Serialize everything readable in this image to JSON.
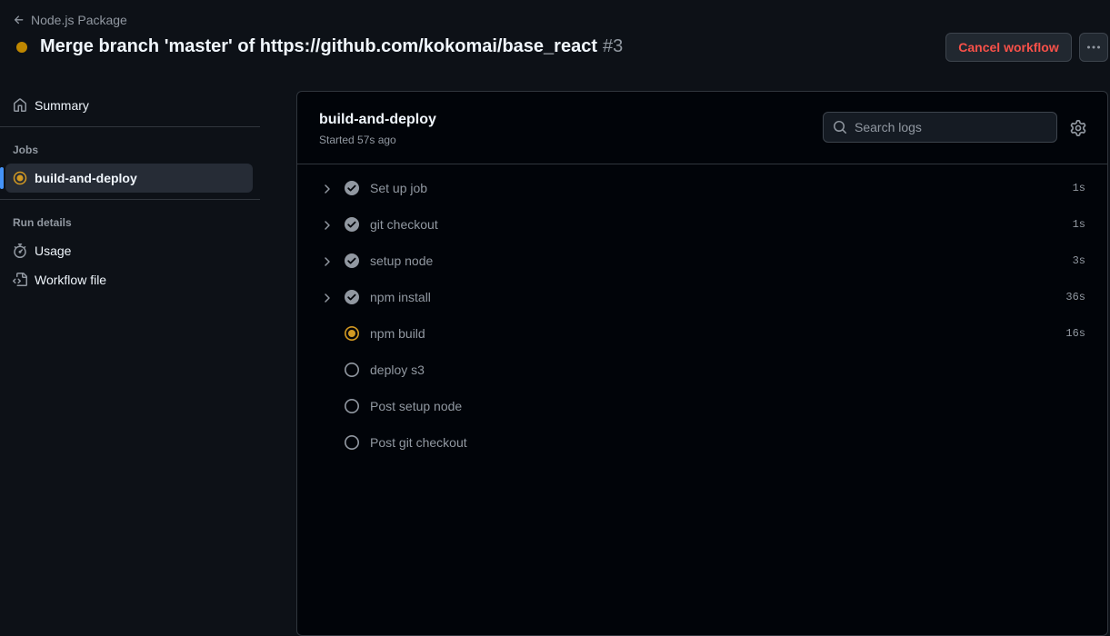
{
  "header": {
    "back_label": "Node.js Package",
    "run_title": "Merge branch 'master' of https://github.com/kokomai/base_react",
    "run_number": "#3",
    "cancel_label": "Cancel workflow",
    "status_color": "#bf8700"
  },
  "sidebar": {
    "summary_label": "Summary",
    "jobs_heading": "Jobs",
    "jobs": [
      {
        "label": "build-and-deploy",
        "status": "in-progress"
      }
    ],
    "run_details_heading": "Run details",
    "usage_label": "Usage",
    "workflow_file_label": "Workflow file"
  },
  "job": {
    "title": "build-and-deploy",
    "started": "Started 57s ago",
    "search_placeholder": "Search logs",
    "steps": [
      {
        "name": "Set up job",
        "duration": "1s",
        "status": "success",
        "expandable": true
      },
      {
        "name": "git checkout",
        "duration": "1s",
        "status": "success",
        "expandable": true
      },
      {
        "name": "setup node",
        "duration": "3s",
        "status": "success",
        "expandable": true
      },
      {
        "name": "npm install",
        "duration": "36s",
        "status": "success",
        "expandable": true
      },
      {
        "name": "npm build",
        "duration": "16s",
        "status": "in-progress",
        "expandable": false
      },
      {
        "name": "deploy s3",
        "duration": "",
        "status": "queued",
        "expandable": false
      },
      {
        "name": "Post setup node",
        "duration": "",
        "status": "queued",
        "expandable": false
      },
      {
        "name": "Post git checkout",
        "duration": "",
        "status": "queued",
        "expandable": false
      }
    ]
  },
  "colors": {
    "accent_blue": "#4493f8",
    "in_progress": "#d29922",
    "success_icon": "#9198a1",
    "danger": "#f85149"
  }
}
